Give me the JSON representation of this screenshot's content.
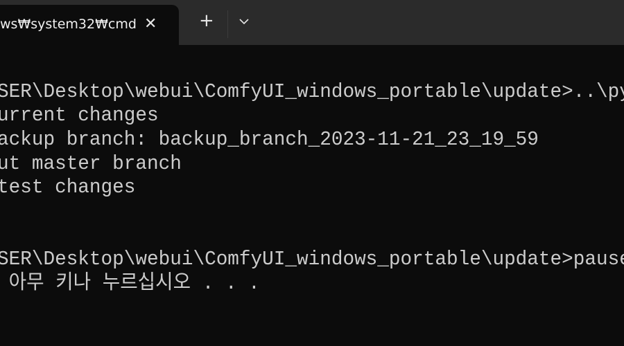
{
  "tab": {
    "title": "ws₩system32₩cmd",
    "close_icon": "close-icon",
    "new_tab_icon": "plus-icon",
    "dropdown_icon": "chevron-down-icon"
  },
  "terminal": {
    "lines": [
      "SER\\Desktop\\webui\\ComfyUI_windows_portable\\update>..\\py",
      "urrent changes",
      "ackup branch: backup_branch_2023-11-21_23_19_59",
      "ut master branch",
      "test changes",
      "",
      "",
      "SER\\Desktop\\webui\\ComfyUI_windows_portable\\update>pause",
      " 아무 키나 누르십시오 . . ."
    ]
  },
  "colors": {
    "titlebar": "#2b2b2b",
    "background": "#0c0c0c",
    "text": "#cccccc"
  }
}
